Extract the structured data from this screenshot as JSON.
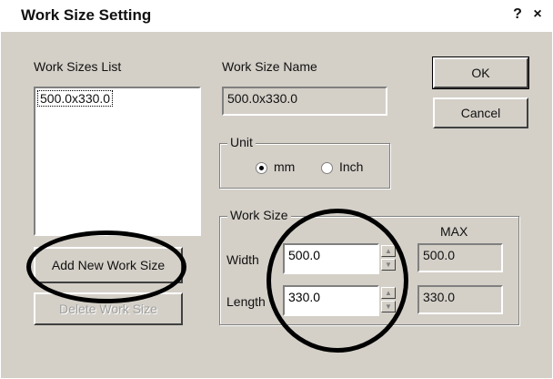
{
  "dialog": {
    "title": "Work Size Setting",
    "help_button": "?",
    "close_button": "×"
  },
  "work_sizes_list": {
    "label": "Work Sizes List",
    "items": [
      "500.0x330.0"
    ]
  },
  "work_size_name": {
    "label": "Work Size Name",
    "value": "500.0x330.0"
  },
  "buttons": {
    "ok": "OK",
    "cancel": "Cancel",
    "add_new": "Add New Work Size",
    "delete": "Delete Work Size"
  },
  "unit": {
    "label": "Unit",
    "options": [
      "mm",
      "Inch"
    ],
    "selected": "mm"
  },
  "work_size": {
    "label": "Work Size",
    "max_label": "MAX",
    "width_label": "Width",
    "length_label": "Length",
    "width_value": "500.0",
    "length_value": "330.0",
    "width_max": "500.0",
    "length_max": "330.0"
  }
}
